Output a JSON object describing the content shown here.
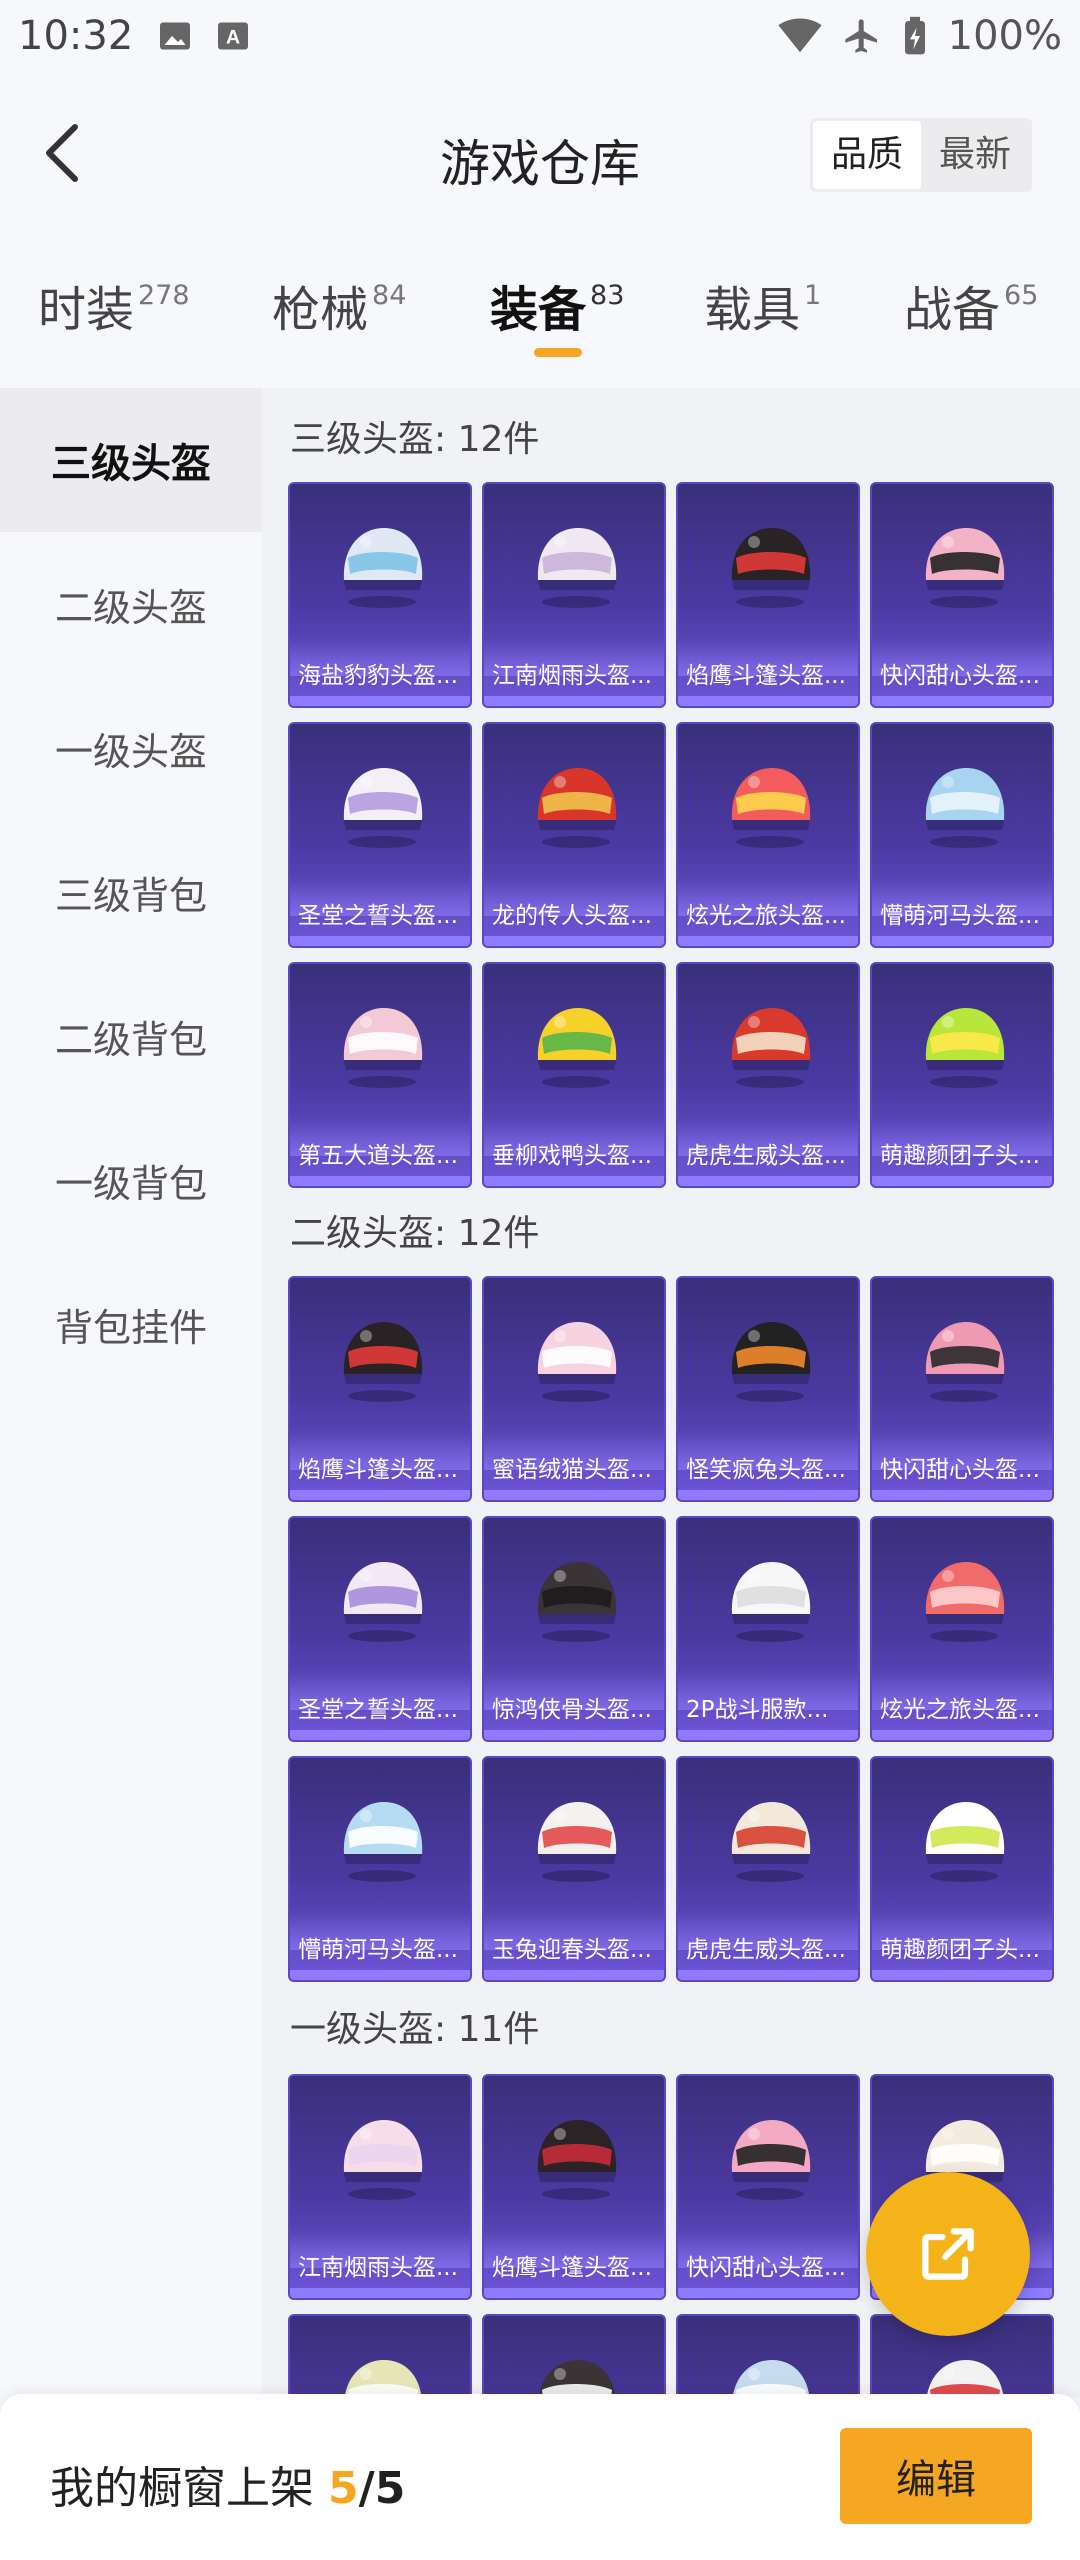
{
  "status": {
    "time": "10:32",
    "battery": "100%"
  },
  "header": {
    "title": "游戏仓库",
    "sort_quality": "品质",
    "sort_newest": "最新"
  },
  "tabs": [
    {
      "label": "时装",
      "count": "278"
    },
    {
      "label": "枪械",
      "count": "84"
    },
    {
      "label": "装备",
      "count": "83"
    },
    {
      "label": "载具",
      "count": "1"
    },
    {
      "label": "战备",
      "count": "65"
    }
  ],
  "sidebar": [
    {
      "label": "三级头盔"
    },
    {
      "label": "二级头盔"
    },
    {
      "label": "一级头盔"
    },
    {
      "label": "三级背包"
    },
    {
      "label": "二级背包"
    },
    {
      "label": "一级背包"
    },
    {
      "label": "背包挂件"
    }
  ],
  "sections": [
    {
      "title": "三级头盔: 12件",
      "items": [
        {
          "name": "海盐豹豹头盔...",
          "color": "#dfe9f5",
          "accent": "#7fc3e8"
        },
        {
          "name": "江南烟雨头盔...",
          "color": "#f0e9f3",
          "accent": "#c9b2d9"
        },
        {
          "name": "焰鹰斗篷头盔...",
          "color": "#2a2326",
          "accent": "#e23a3a"
        },
        {
          "name": "快闪甜心头盔...",
          "color": "#f3b3c6",
          "accent": "#222222"
        },
        {
          "name": "圣堂之誓头盔...",
          "color": "#f4eef6",
          "accent": "#b49be0"
        },
        {
          "name": "龙的传人头盔...",
          "color": "#d8352b",
          "accent": "#f0c24a"
        },
        {
          "name": "炫光之旅头盔...",
          "color": "#f25c5c",
          "accent": "#ffd84a"
        },
        {
          "name": "懵萌河马头盔...",
          "color": "#a7d4f0",
          "accent": "#e9f4fb"
        },
        {
          "name": "第五大道头盔...",
          "color": "#f4c9d6",
          "accent": "#ffffff"
        },
        {
          "name": "垂柳戏鸭头盔...",
          "color": "#f6d12a",
          "accent": "#59b54a"
        },
        {
          "name": "虎虎生威头盔...",
          "color": "#d93a2c",
          "accent": "#f4e3c8"
        },
        {
          "name": "萌趣颜团子头...",
          "color": "#b8e63a",
          "accent": "#ffe94a"
        }
      ]
    },
    {
      "title": "二级头盔: 12件",
      "items": [
        {
          "name": "焰鹰斗篷头盔...",
          "color": "#2a2326",
          "accent": "#e23a3a"
        },
        {
          "name": "蜜语绒猫头盔...",
          "color": "#f7d3df",
          "accent": "#ffffff"
        },
        {
          "name": "怪笑疯兔头盔...",
          "color": "#222222",
          "accent": "#f08a2c"
        },
        {
          "name": "快闪甜心头盔...",
          "color": "#f09ab2",
          "accent": "#2a2a2a"
        },
        {
          "name": "圣堂之誓头盔...",
          "color": "#f1eaf6",
          "accent": "#a98ddb"
        },
        {
          "name": "惊鸿侠骨头盔...",
          "color": "#3a3436",
          "accent": "#1f1b1c"
        },
        {
          "name": "2P战斗服款...",
          "color": "#f7f7f7",
          "accent": "#dddddd"
        },
        {
          "name": "炫光之旅头盔...",
          "color": "#f16b6b",
          "accent": "#ffd2d2"
        },
        {
          "name": "懵萌河马头盔...",
          "color": "#b5dcf3",
          "accent": "#ffffff"
        },
        {
          "name": "玉兔迎春头盔...",
          "color": "#f4f0ee",
          "accent": "#e34a4a"
        },
        {
          "name": "虎虎生威头盔...",
          "color": "#f3e8da",
          "accent": "#d8402f"
        },
        {
          "name": "萌趣颜团子头...",
          "color": "#ffffff",
          "accent": "#cde94a"
        }
      ]
    },
    {
      "title": "一级头盔: 11件",
      "items": [
        {
          "name": "江南烟雨头盔...",
          "color": "#f7dde8",
          "accent": "#e9d4f0"
        },
        {
          "name": "焰鹰斗篷头盔...",
          "color": "#2b2326",
          "accent": "#c72b3a"
        },
        {
          "name": "快闪甜心头盔...",
          "color": "#f3a9c1",
          "accent": "#222222"
        },
        {
          "name": "",
          "color": "#f4ebe0",
          "accent": "#ffffff"
        },
        {
          "name": "",
          "color": "#e7e5b5",
          "accent": "#ffffff"
        },
        {
          "name": "",
          "color": "#3a3436",
          "accent": "#ffffff"
        },
        {
          "name": "",
          "color": "#c6dcee",
          "accent": "#ffffff"
        },
        {
          "name": "",
          "color": "#f2f2f2",
          "accent": "#e03a3a"
        }
      ]
    }
  ],
  "bottom": {
    "shelf_label": "我的橱窗上架 ",
    "shelf_count": "5",
    "shelf_total": "/5",
    "edit_label": "编辑"
  },
  "colors": {
    "accent": "#f5a623",
    "card_top": "#3a2f7a",
    "card_bottom": "#6e56d8"
  },
  "icons": {
    "back": "chevron-left-icon",
    "share": "external-link-icon"
  }
}
